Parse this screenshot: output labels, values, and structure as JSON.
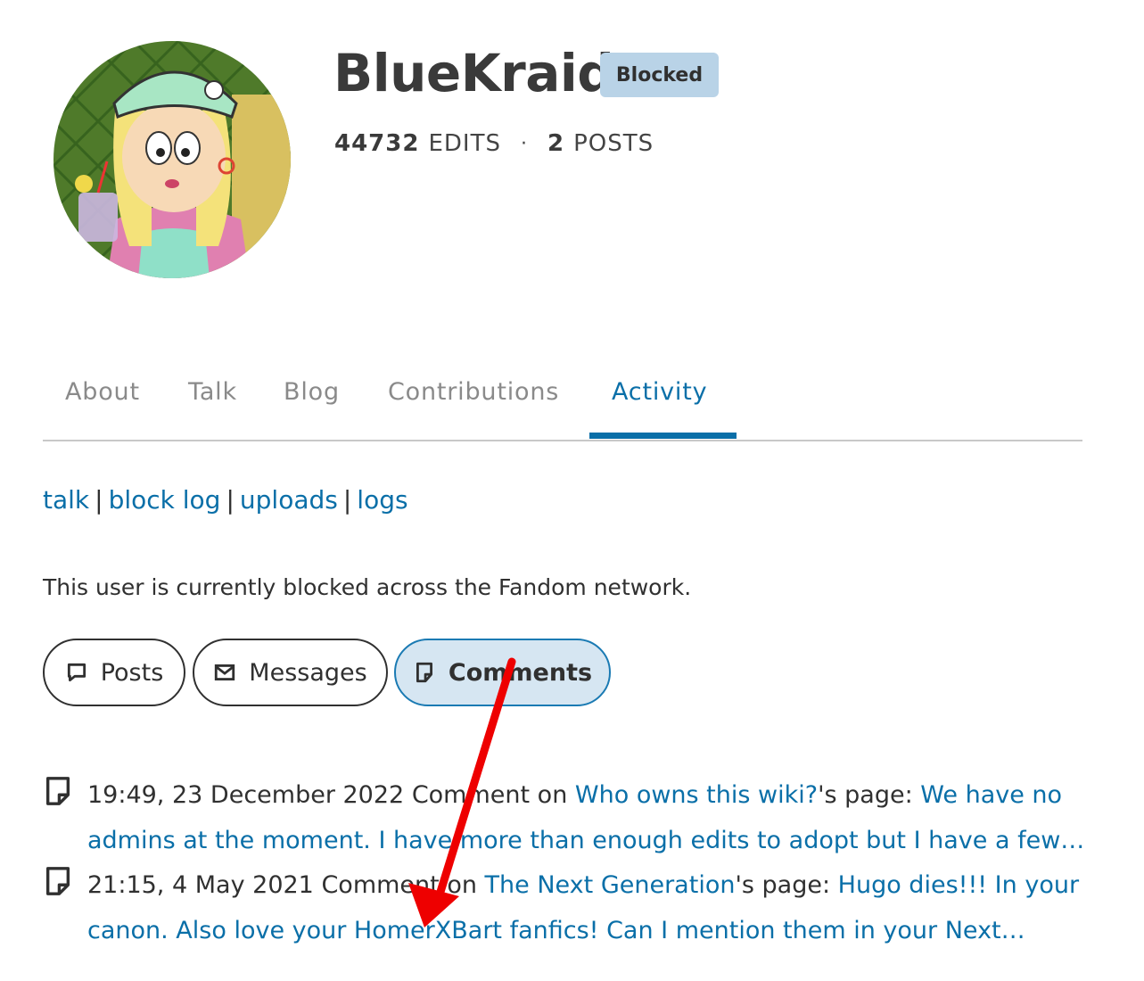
{
  "profile": {
    "username": "BlueKraid",
    "badge": "Blocked",
    "edits_count": "44732",
    "edits_label": "EDITS",
    "separator": "·",
    "posts_count": "2",
    "posts_label": "POSTS"
  },
  "tabs": [
    {
      "label": "About"
    },
    {
      "label": "Talk"
    },
    {
      "label": "Blog"
    },
    {
      "label": "Contributions"
    },
    {
      "label": "Activity",
      "active": true
    }
  ],
  "links": {
    "talk": "talk",
    "block_log": "block log",
    "uploads": "uploads",
    "logs": "logs",
    "separator": "|"
  },
  "notice": "This user is currently blocked across the Fandom network.",
  "filters": [
    {
      "label": "Posts",
      "icon": "speech-bubble-icon"
    },
    {
      "label": "Messages",
      "icon": "envelope-icon"
    },
    {
      "label": "Comments",
      "icon": "comment-doc-icon",
      "active": true
    }
  ],
  "activity": [
    {
      "timestamp": "19:49, 23 December 2022",
      "action": "Comment on",
      "page": "Who owns this wiki?",
      "page_suffix": "'s page:",
      "excerpt_1": "We have no",
      "excerpt_2": "admins at the moment. I have more than enough edits to adopt but I have a few…"
    },
    {
      "timestamp": "21:15, 4 May 2021",
      "action": "Comment on",
      "page": "The Next Generation",
      "page_suffix": "'s page:",
      "excerpt_1": "Hugo dies!!! In your",
      "excerpt_2": "canon. Also love your HomerXBart fanfics! Can I mention them in your Next…"
    }
  ],
  "colors": {
    "link": "#0a6fa8",
    "badge_bg": "#b9d3e7",
    "active_pill_bg": "#d6e6f2",
    "arrow": "#ee0000"
  }
}
